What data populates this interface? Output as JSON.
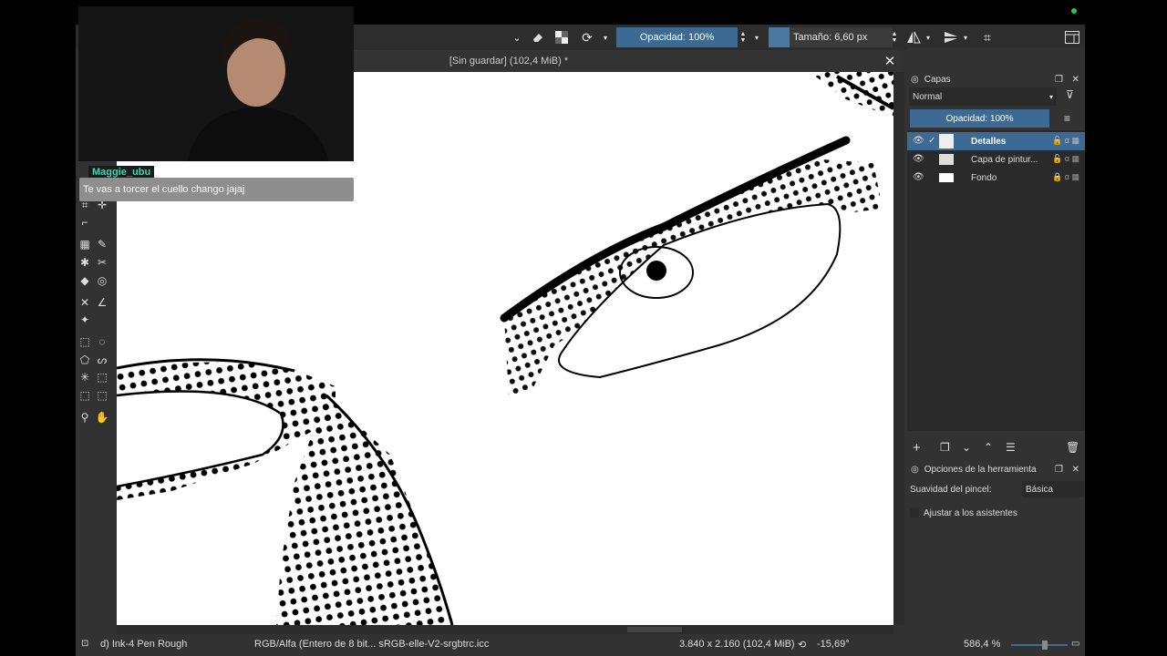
{
  "toolbar": {
    "opacity_label": "Opacidad: 100%",
    "size_label": "Tamaño: 6,60 px"
  },
  "document": {
    "title": "[Sin guardar]  (102,4 MiB) *"
  },
  "layers_panel": {
    "title": "Capas",
    "blend_mode": "Normal",
    "opacity": "Opacidad:  100%",
    "layers": [
      {
        "name": "Detalles",
        "active": true
      },
      {
        "name": "Capa de pintur...",
        "active": false
      },
      {
        "name": "Fondo",
        "active": false
      }
    ]
  },
  "tool_options": {
    "title": "Opciones de la herramienta",
    "smoothing_label": "Suavidad del pincel:",
    "smoothing_value": "Básica",
    "assistants_label": "Ajustar a los asistentes"
  },
  "statusbar": {
    "brush": "d) Ink-4 Pen Rough",
    "color_profile": "RGB/Alfa (Entero de 8 bit... sRGB-elle-V2-srgbtrc.icc",
    "image_size": "3.840 x 2.160 (102,4 MiB)",
    "rotation": "-15,69°",
    "zoom": "586,4 %"
  },
  "chat": {
    "username": "Maggie_ubu",
    "message": "Te vas a torcer el cuello chango jajaj"
  },
  "colors": {
    "accent": "#3d6a92",
    "chat_name": "#3ed6b4",
    "panel_bg": "#323232"
  }
}
